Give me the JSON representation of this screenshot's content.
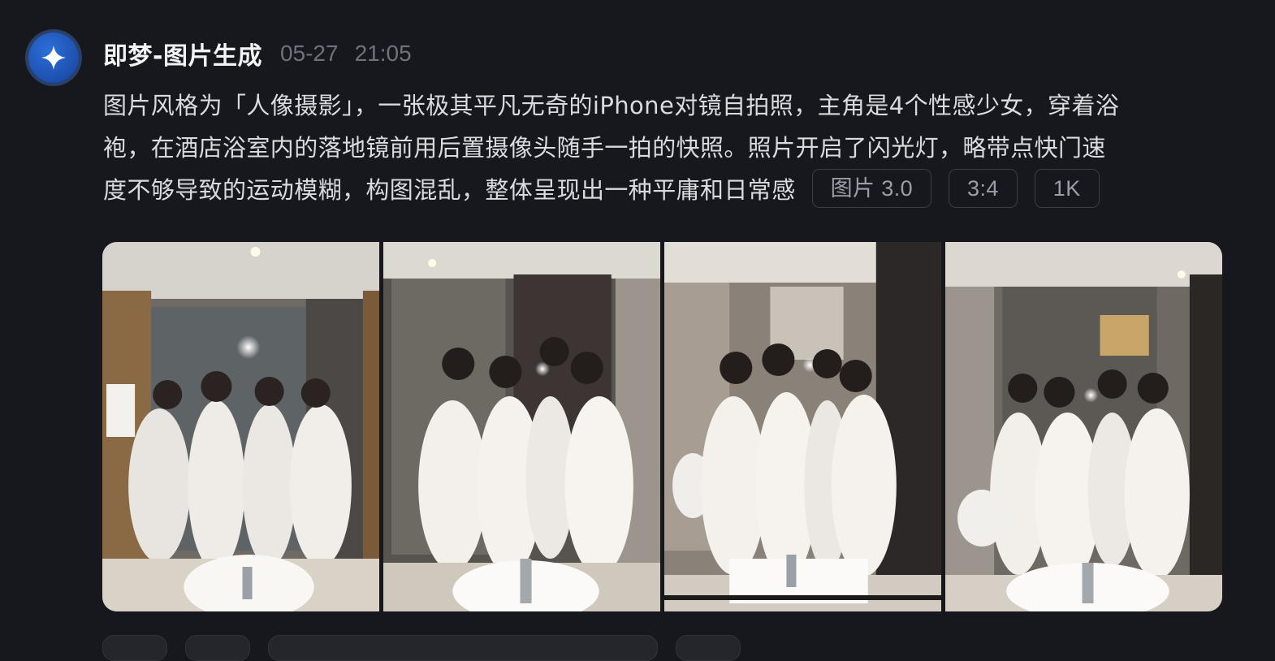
{
  "message": {
    "sender": "即梦-图片生成",
    "date": "05-27",
    "time": "21:05",
    "avatar_icon": "sparkle-icon",
    "prompt_lines": [
      "图片风格为「人像摄影」，一张极其平凡无奇的iPhone对镜自拍照，主角是4个性感少女，穿着浴",
      "袍，在酒店浴室内的落地镜前用后置摄像头随手一拍的快照。照片开启了闪光灯，略带点快门速",
      "度不够导致的运动模糊，构图混乱，整体呈现出一种平庸和日常感"
    ],
    "tags": [
      "图片 3.0",
      "3:4",
      "1K"
    ]
  },
  "gallery": {
    "images": [
      {
        "label": "generated-image-1"
      },
      {
        "label": "generated-image-2"
      },
      {
        "label": "generated-image-3"
      },
      {
        "label": "generated-image-4"
      }
    ]
  },
  "colors": {
    "background": "#17181d",
    "accent": "#2c6fd8",
    "muted_text": "#6e727c",
    "tag_border": "#3a3d45"
  }
}
